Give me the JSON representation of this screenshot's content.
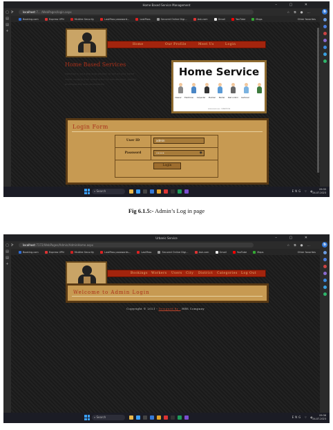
{
  "shot1": {
    "window_title": "Home Based Service Management",
    "url_host": "localhost",
    "url_path": ":7... /WebPages/login.aspx",
    "bookmarks": [
      "Booking.com",
      "Express VPN",
      "McAfee Security",
      "LastPass password...",
      "LastPass",
      "Secured Online Digi...",
      "Ask.com",
      "Gmail",
      "YouTube",
      "Maps"
    ],
    "other_favorites": "Other favorites",
    "nav": [
      "Home",
      "Our Profile",
      "Meet Us",
      "Login"
    ],
    "hero_title": "Home Based Services",
    "hero_text_lines": [
      "Homejoy is your one-stop solution to sort all your home",
      "needs ranging from construction to maintenance, quickly,",
      "professionally and conveniently."
    ],
    "banner_title": "Home Service",
    "banner_labels": [
      "Cleaner",
      "Electrician",
      "Carpenter",
      "Plumber",
      "Painter",
      "Pest control",
      "Gardener"
    ],
    "banner_credit": "shutterstock.com · 1494872294",
    "login_title": "Login Form",
    "user_id_label": "User ID",
    "user_id_value": "admin",
    "password_label": "Password",
    "password_value": "•••••",
    "login_button": "Login",
    "search": "Search",
    "lang": "ENG",
    "lang2": "IN",
    "time": "09:35",
    "date": "24-07-2023"
  },
  "caption": {
    "label": "Fig 6.1.5:-",
    "text": " Admin’s Log in page"
  },
  "shot2": {
    "window_title": "Urbanic Service",
    "url_host": "localhost",
    "url_path": ":7172/WebPages/Admin/AdminHome.aspx",
    "bookmarks": [
      "Booking.com",
      "Express VPN",
      "McAfee Security",
      "LastPass passwords...",
      "LastPass",
      "Secured Online Digi...",
      "Ask.com",
      "Gmail",
      "YouTube",
      "Maps"
    ],
    "other_favorites": "Other favorites",
    "nav": [
      "Bookings",
      "Workers",
      "Users",
      "City",
      "District",
      "Categories",
      "Log Out"
    ],
    "welcome": "Welcome to Admin Login",
    "footer_prefix": "Copyright © 2021 - ",
    "footer_link": "Designed By :",
    "footer_suffix": " HBS Company",
    "search": "Search",
    "lang": "ENG",
    "lang2": "IN",
    "time": "09:36",
    "date": "24-07-2023"
  },
  "colors": {
    "nav_red": "#a3240d",
    "panel_tan": "#c79a52",
    "heading_red": "#a9301a",
    "accent_blue": "#3478d6"
  }
}
